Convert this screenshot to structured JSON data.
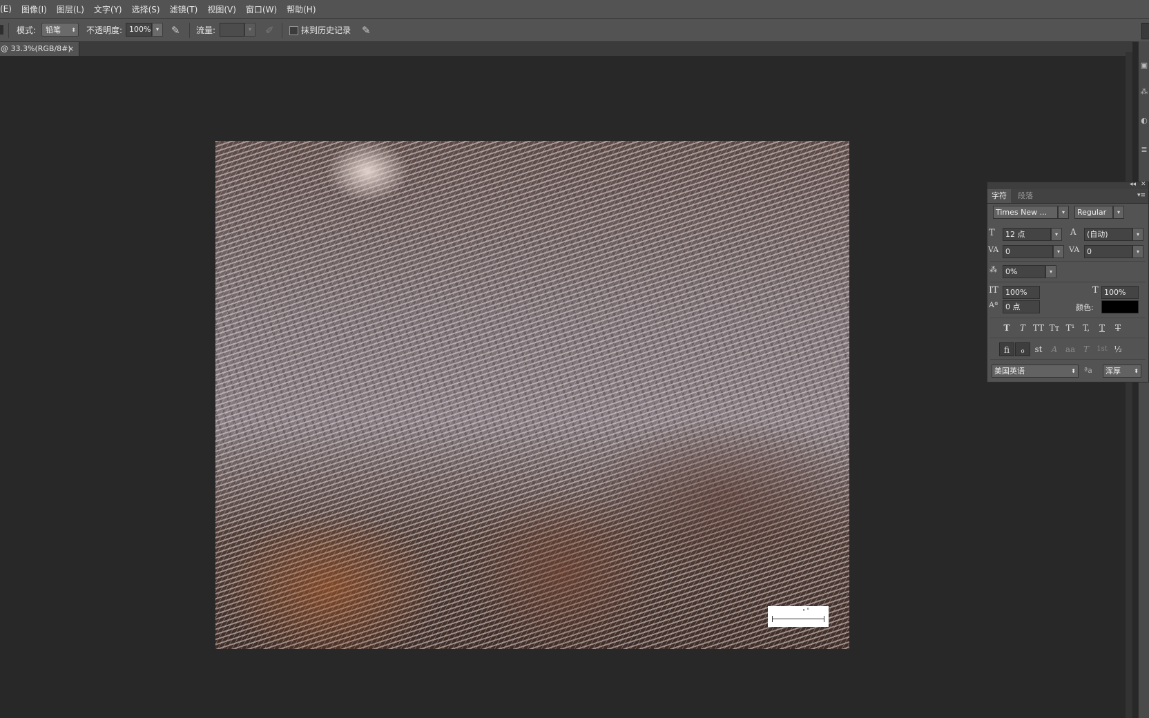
{
  "menu": [
    "(E)",
    "图像(I)",
    "图层(L)",
    "文字(Y)",
    "选择(S)",
    "滤镜(T)",
    "视图(V)",
    "窗口(W)",
    "帮助(H)"
  ],
  "options": {
    "mode_label": "模式:",
    "mode_value": "铅笔",
    "opacity_label": "不透明度:",
    "opacity_value": "100%",
    "flow_label": "流量:",
    "flow_value": "",
    "erase_history_label": "抹到历史记录"
  },
  "document_tab": {
    "title": "@ 33.3%(RGB/8#)",
    "close": "×"
  },
  "character_panel": {
    "tabs": [
      "字符",
      "段落"
    ],
    "font_family": "Times New ...",
    "font_style": "Regular",
    "font_size": "12 点",
    "leading": "(自动)",
    "kerning": "0",
    "tracking": "0",
    "tsume": "0%",
    "vertical_scale": "100%",
    "horizontal_scale": "100%",
    "baseline_shift": "0 点",
    "color_label": "颜色:",
    "color_value": "#000000",
    "type_buttons": [
      "T",
      "T",
      "TT",
      "Tт",
      "T¹",
      "T,",
      "T",
      "T"
    ],
    "opentype_buttons": [
      "ﬁ",
      "ℴ",
      "st",
      "A",
      "aa",
      "T",
      "1st",
      "½"
    ],
    "language": "美国英语",
    "antialias_icon": "ªa",
    "antialias": "浑厚"
  },
  "icons": {
    "pressure_opacity": "tablet-pressure-icon",
    "airbrush": "airbrush-icon",
    "pressure_size": "tablet-pressure-icon"
  }
}
